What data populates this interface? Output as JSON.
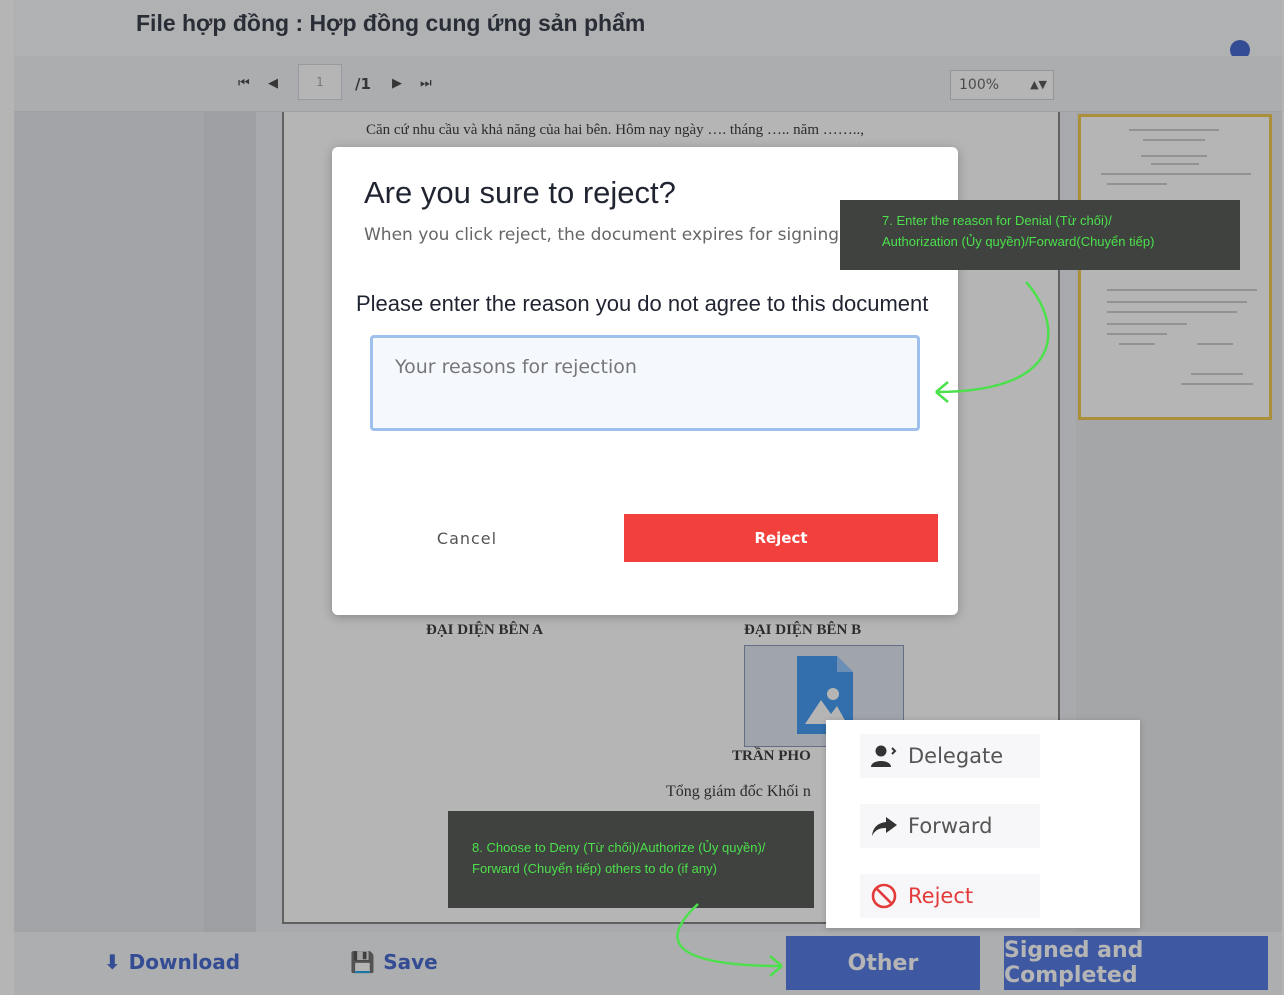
{
  "header": {
    "title": "File hợp đồng : Hợp đồng cung ứng sản phẩm"
  },
  "toolbar": {
    "page_current": "1",
    "page_total": "/1",
    "zoom": "100%"
  },
  "document": {
    "line_1": "Căn cứ nhu cầu và khả năng của hai bên. Hôm nay ngày …. tháng ….. năm ……..,",
    "rep_a": "ĐẠI DIỆN BÊN A",
    "rep_b": "ĐẠI DIỆN BÊN B",
    "signer_name": "TRẦN PHO",
    "signer_title": "Tổng giám đốc Khối n"
  },
  "modal": {
    "title": "Are you sure to reject?",
    "subtitle": "When you click reject, the document expires for signing",
    "reason_label": "Please enter the reason you do not agree to this document",
    "reason_placeholder": "Your reasons for rejection",
    "cancel_label": "Cancel",
    "reject_label": "Reject"
  },
  "tooltips": {
    "step7_line1": "7. Enter the reason for Denial (Từ chối)/",
    "step7_line2": "Authorization (Ủy quyền)/Forward(Chuyển tiếp)",
    "step8_line1": "8. Choose to Deny (Từ chối)/Authorize (Ủy quyền)/",
    "step8_line2": "Forward (Chuyển tiếp) others to do (if any)"
  },
  "menu": {
    "delegate": "Delegate",
    "forward": "Forward",
    "reject": "Reject"
  },
  "footer": {
    "download": "Download",
    "save": "Save",
    "other": "Other",
    "signed_completed": "Signed and Completed"
  },
  "colors": {
    "primary": "#3f6be0",
    "danger": "#f2413c",
    "tooltip_bg": "#3f423f",
    "tooltip_text": "#4ce04c",
    "arrow": "#4ce04c"
  }
}
